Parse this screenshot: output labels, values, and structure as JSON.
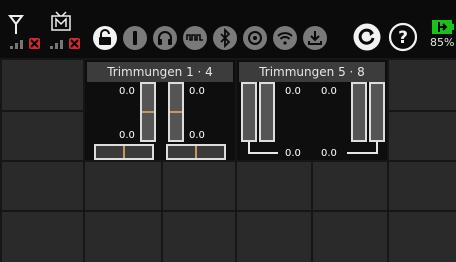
{
  "topbar": {
    "icons": [
      "antenna-signal-icon",
      "tx-monitor-signal-icon",
      "unlock-icon",
      "info-icon",
      "headphones-icon",
      "waveform-icon",
      "bluetooth-icon",
      "target-icon",
      "wifi-icon",
      "download-icon",
      "refresh-icon",
      "help-icon",
      "battery-icon"
    ],
    "battery_percent": "85%"
  },
  "panels": [
    {
      "title": "Trimmungen 1 · 4",
      "values": [
        "0.0",
        "0.0",
        "0.0",
        "0.0"
      ]
    },
    {
      "title": "Trimmungen 5 · 8",
      "values": [
        "0.0",
        "0.0",
        "0.0",
        "0.0"
      ]
    }
  ],
  "colors": {
    "accent_green": "#19c21b",
    "alert_red": "#d22b2b",
    "trim_marker": "#c89a5a"
  }
}
